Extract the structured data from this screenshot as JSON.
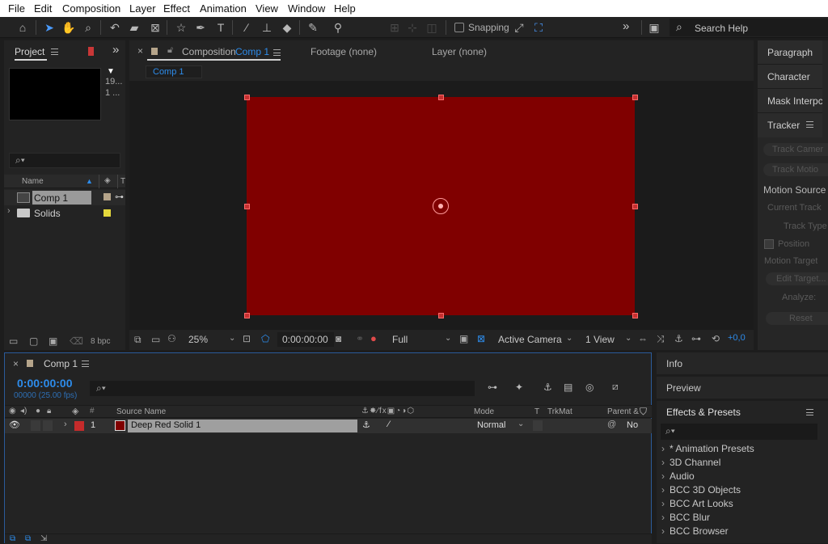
{
  "menu": [
    "File",
    "Edit",
    "Composition",
    "Layer",
    "Effect",
    "Animation",
    "View",
    "Window",
    "Help"
  ],
  "toolbar": {
    "snapping_label": "Snapping",
    "search_placeholder": "Search Help",
    "overflow": "»"
  },
  "project": {
    "tab_label": "Project",
    "thumb_info1": "19...",
    "thumb_info2": "1 ...",
    "search_icon": "⌕▾",
    "col_name": "Name",
    "items": [
      {
        "name": "Comp 1",
        "label_color": "#b5a48a",
        "icon": "composition-icon"
      },
      {
        "name": "Solids",
        "label_color": "#e4d83c",
        "icon": "folder-icon"
      }
    ],
    "bpc": "8 bpc"
  },
  "viewer": {
    "close": "×",
    "comp_tab_prefix": "Composition",
    "comp_tab_name": "Comp 1",
    "footage_tab": "Footage (none)",
    "layer_tab": "Layer (none)",
    "breadcrumb": "Comp 1",
    "solid_color": "#800000",
    "zoom": "25%",
    "timecode": "0:00:00:00",
    "resolution": "Full",
    "camera": "Active Camera",
    "views": "1 View",
    "exposure": "+0,0"
  },
  "right_panel": {
    "items": [
      "Paragraph",
      "Character",
      "Mask Interpc",
      "Tracker"
    ],
    "tracker_buttons": [
      "Track Camer",
      "Track Motio"
    ],
    "motion_source": "Motion Source",
    "current_track": "Current Track",
    "track_type": "Track Type",
    "position": "Position",
    "motion_target": "Motion Target",
    "edit_target": "Edit Target...",
    "analyze": "Analyze:",
    "reset": "Reset"
  },
  "timeline": {
    "close": "×",
    "tab_label": "Comp 1",
    "timecode": "0:00:00:00",
    "frames": "00000 (25.00 fps)",
    "columns": {
      "source_name": "Source Name",
      "mode": "Mode",
      "t": "T",
      "trkmat": "TrkMat",
      "parent": "Parent &"
    },
    "layers": [
      {
        "index": "1",
        "name": "Deep Red Solid 1",
        "mode": "Normal",
        "parent": "No",
        "color": "#c52b2b",
        "swatch": "#800000"
      }
    ]
  },
  "info_panel": {
    "info": "Info",
    "preview": "Preview",
    "effects_title": "Effects & Presets",
    "effects": [
      "* Animation Presets",
      "3D Channel",
      "Audio",
      "BCC 3D Objects",
      "BCC Art Looks",
      "BCC Blur",
      "BCC Browser"
    ]
  }
}
